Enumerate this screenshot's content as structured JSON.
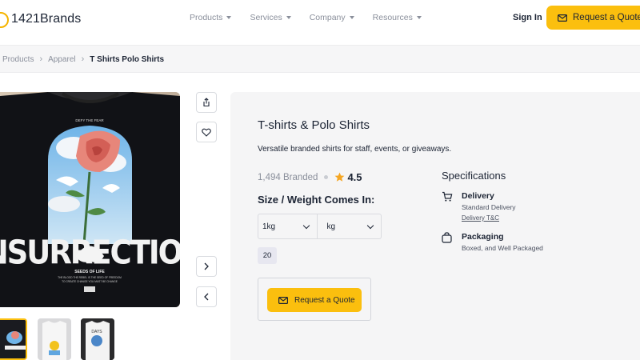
{
  "header": {
    "brand": "1421Brands",
    "nav": [
      {
        "label": "Products"
      },
      {
        "label": "Services"
      },
      {
        "label": "Company"
      },
      {
        "label": "Resources"
      }
    ],
    "sign_in": "Sign In",
    "request_quote": "Request a Quote"
  },
  "breadcrumb": {
    "items": [
      "Products",
      "Apparel",
      "T Shirts Polo Shirts"
    ]
  },
  "gallery": {
    "main_image": "black t-shirt with rose and dove print",
    "thumbnails": [
      "black t-shirt print",
      "white t-shirt yellow print",
      "white t-shirt blue print"
    ]
  },
  "product": {
    "title": "T-shirts & Polo Shirts",
    "description": "Versatile branded shirts for staff, events, or giveaways.",
    "branded_count": "1,494 Branded",
    "rating": "4.5",
    "size_heading": "Size / Weight Comes In:",
    "weight_value": "1kg",
    "unit_value": "kg",
    "quantity_option": "20",
    "quote_button": "Request a Quote"
  },
  "specifications": {
    "heading": "Specifications",
    "delivery_title": "Delivery",
    "delivery_sub": "Standard Delivery",
    "delivery_link": "Delivery T&C",
    "packaging_title": "Packaging",
    "packaging_sub": "Boxed, and Well Packaged"
  },
  "colors": {
    "accent": "#fbbf0e",
    "panel": "#f5f5f6",
    "text": "#1c2434",
    "muted": "#8a8f9b"
  }
}
